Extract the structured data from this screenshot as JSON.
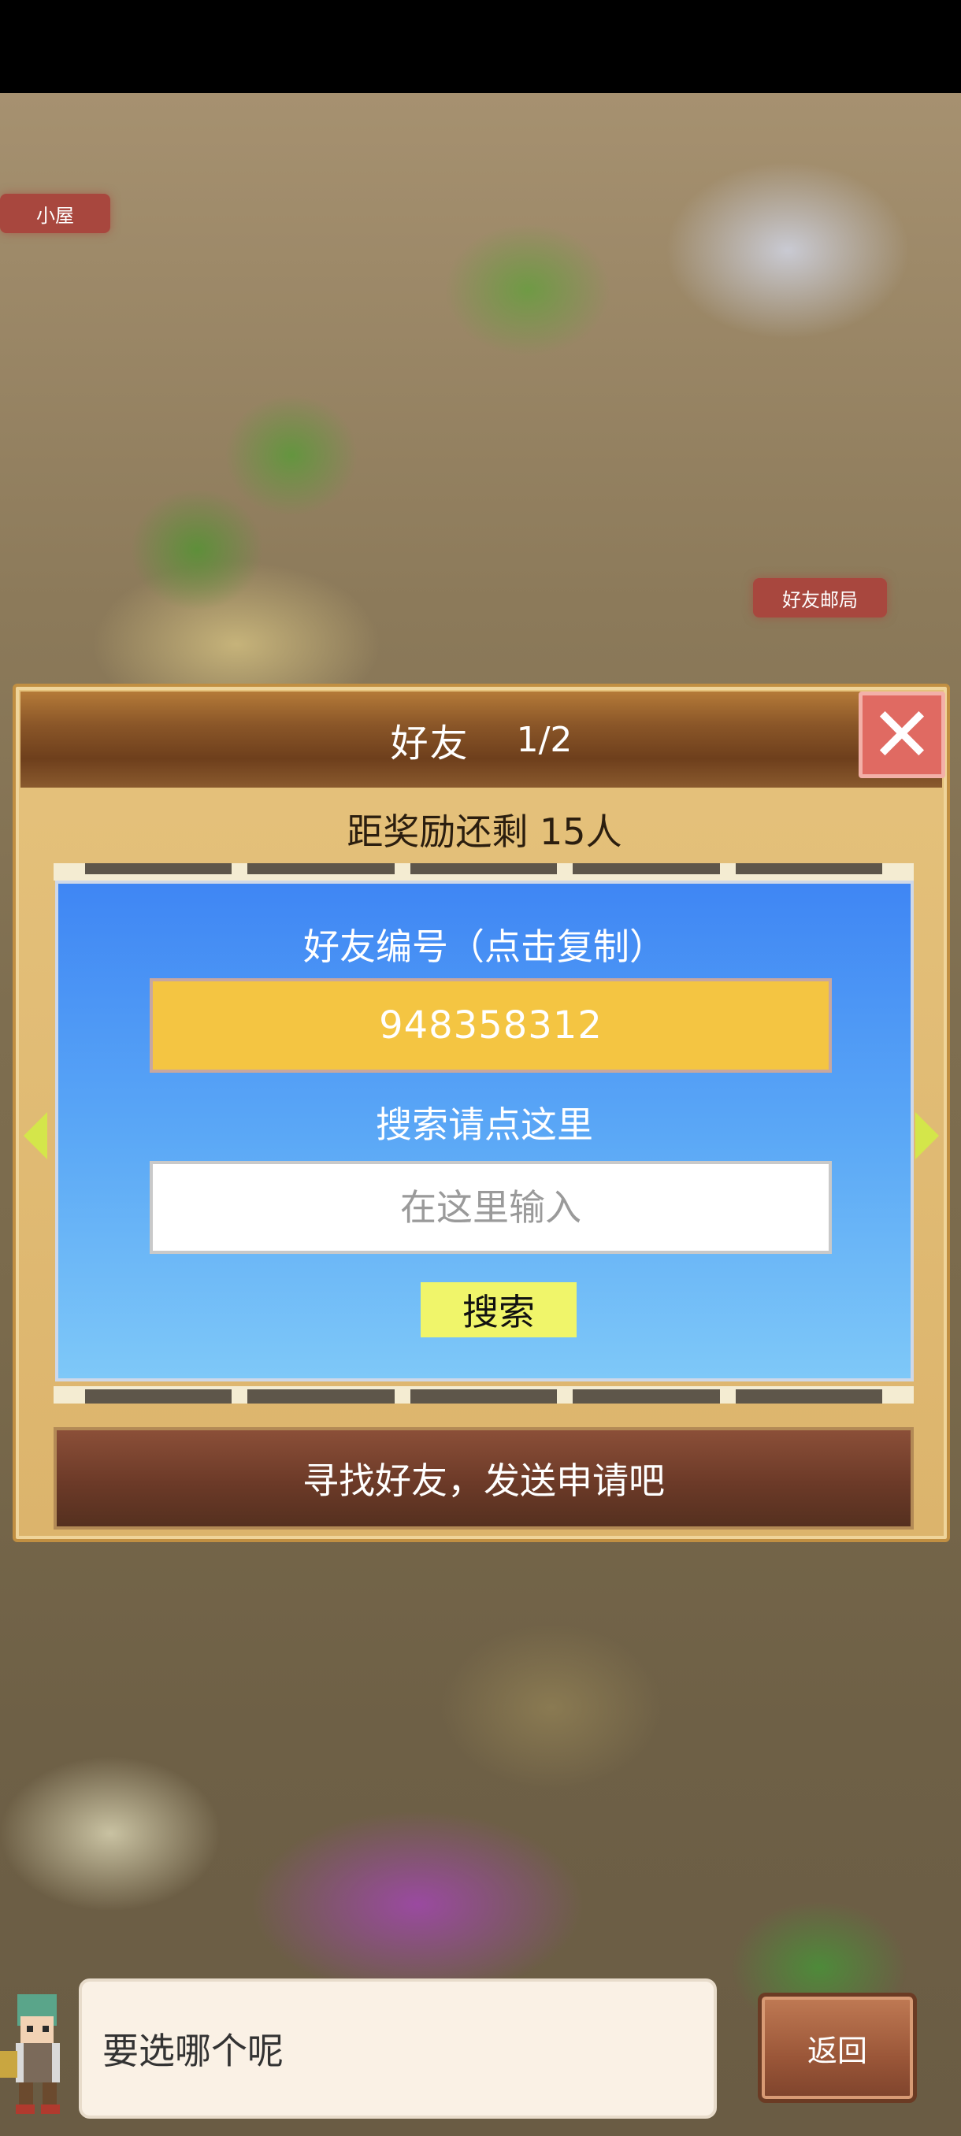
{
  "map": {
    "tag_hut": "小屋",
    "tag_post_office": "好友邮局"
  },
  "panel": {
    "title": "好友",
    "page": "1/2",
    "reward_text": "距奖励还剩 15人",
    "close_icon": "close-icon"
  },
  "friend_box": {
    "id_label": "好友编号（点击复制）",
    "friend_id": "948358312",
    "search_label": "搜索请点这里",
    "search_placeholder": "在这里输入",
    "search_button": "搜索"
  },
  "find_button": "寻找好友，发送申请吧",
  "footer": {
    "dialog_text": "要选哪个呢",
    "back_button": "返回"
  },
  "colors": {
    "panel_bg": "#dcb46c",
    "header_brown": "#6e3f1c",
    "close_red": "#e06a62",
    "box_blue": "#3f86f4",
    "id_yellow": "#f4c542",
    "search_btn_yellow": "#f0f56a",
    "find_btn_brown": "#6c3a28"
  }
}
